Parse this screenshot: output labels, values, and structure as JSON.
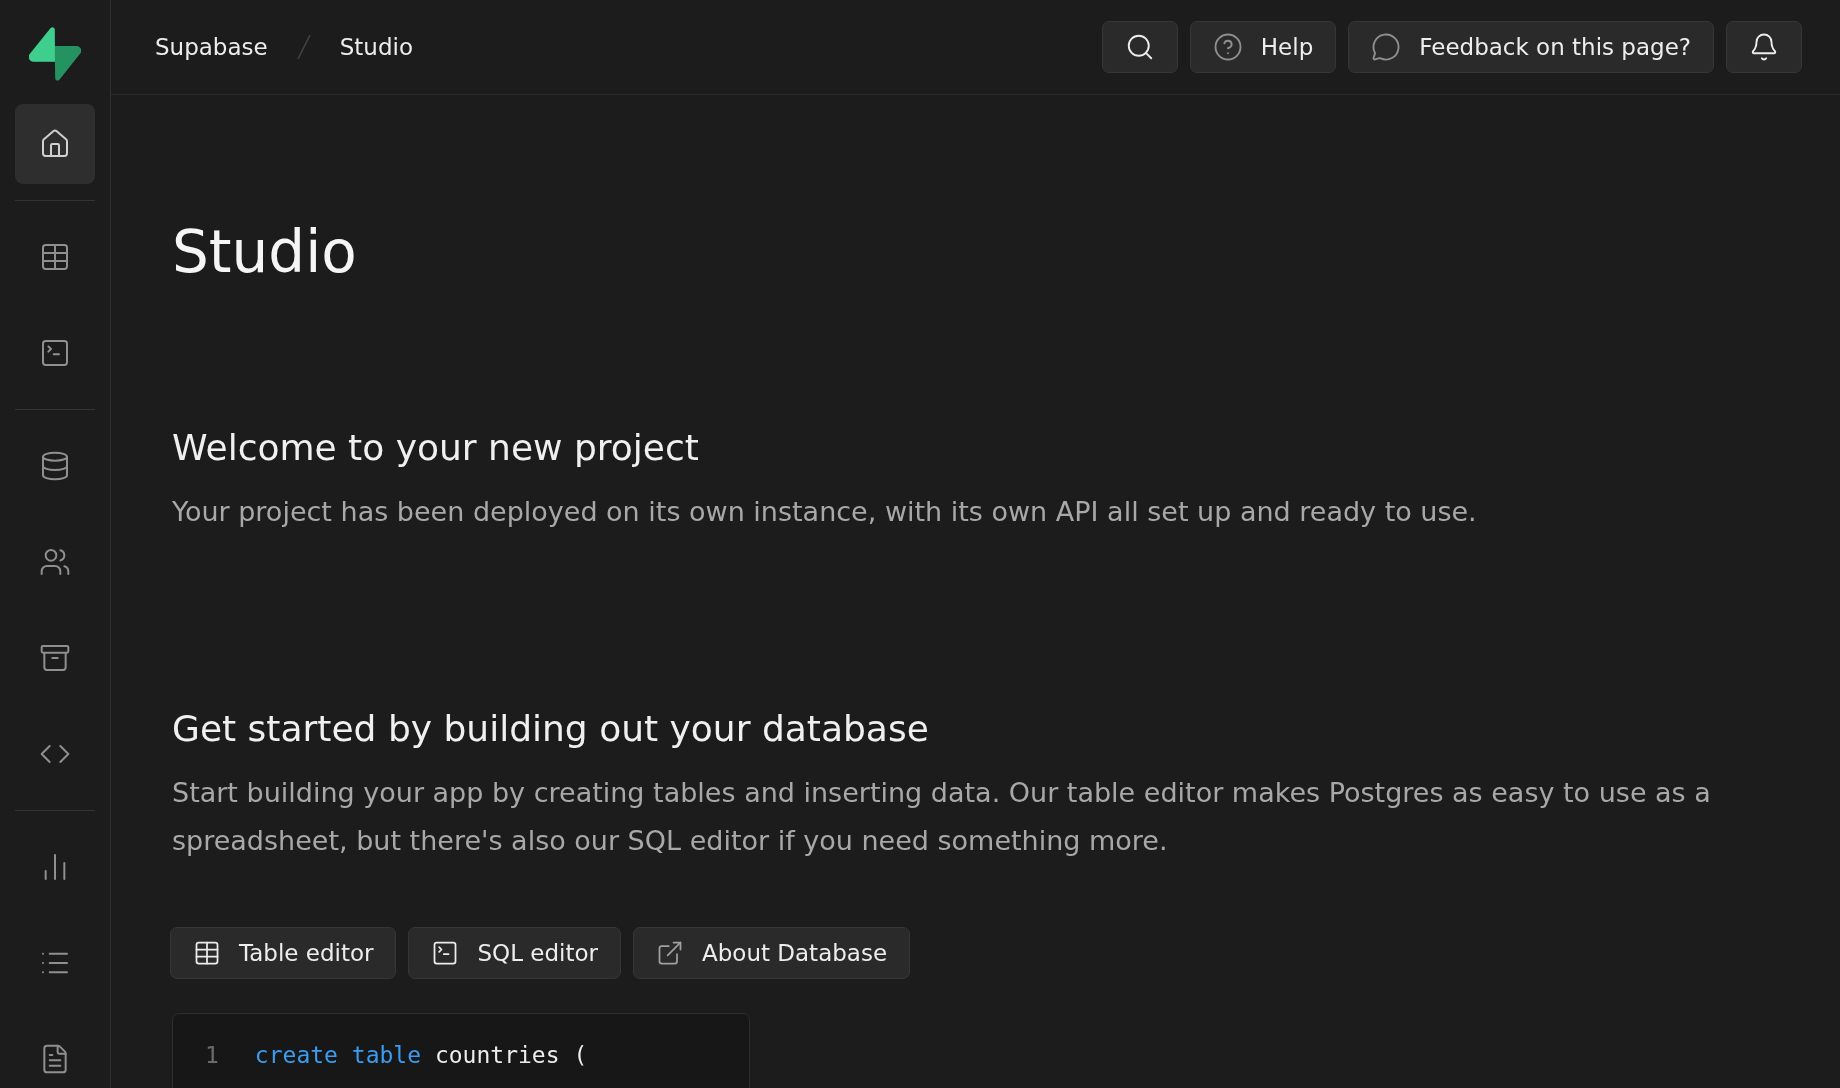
{
  "sidebar": {
    "groups": [
      {
        "items": [
          {
            "kind": "home",
            "selected": true
          }
        ]
      },
      {
        "items": [
          {
            "kind": "table",
            "selected": false
          },
          {
            "kind": "terminal",
            "selected": false
          }
        ]
      },
      {
        "items": [
          {
            "kind": "database",
            "selected": false
          },
          {
            "kind": "users",
            "selected": false
          },
          {
            "kind": "archive",
            "selected": false
          },
          {
            "kind": "code",
            "selected": false
          }
        ]
      },
      {
        "items": [
          {
            "kind": "chart",
            "selected": false
          },
          {
            "kind": "list",
            "selected": false
          },
          {
            "kind": "file",
            "selected": false
          }
        ]
      }
    ]
  },
  "breadcrumb": [
    "Supabase",
    "Studio"
  ],
  "header_actions": [
    {
      "kind": "search"
    },
    {
      "kind": "help",
      "label": "Help"
    },
    {
      "kind": "feedback",
      "label": "Feedback on this page?"
    },
    {
      "kind": "bell"
    }
  ],
  "page_title": "Studio",
  "sections": [
    {
      "heading": "Welcome to your new project",
      "text": "Your project has been deployed on its own instance, with its own API all set up and ready to use."
    },
    {
      "heading": "Get started by building out your database",
      "text": "Start building your app by creating tables and inserting data. Our table editor makes Postgres as easy to use as a spreadsheet, but there's also our SQL editor if you need something more."
    }
  ],
  "buttons": [
    {
      "kind": "table",
      "label": "Table editor"
    },
    {
      "kind": "terminal",
      "label": "SQL editor"
    },
    {
      "kind": "external",
      "label": "About Database"
    }
  ],
  "code": [
    {
      "number": "1",
      "tokens": [
        {
          "kind": "keyword",
          "text": "create"
        },
        {
          "kind": "keyword",
          "text": "table"
        },
        {
          "kind": "plain",
          "text": "countries"
        },
        {
          "kind": "plain",
          "text": "("
        }
      ]
    }
  ]
}
